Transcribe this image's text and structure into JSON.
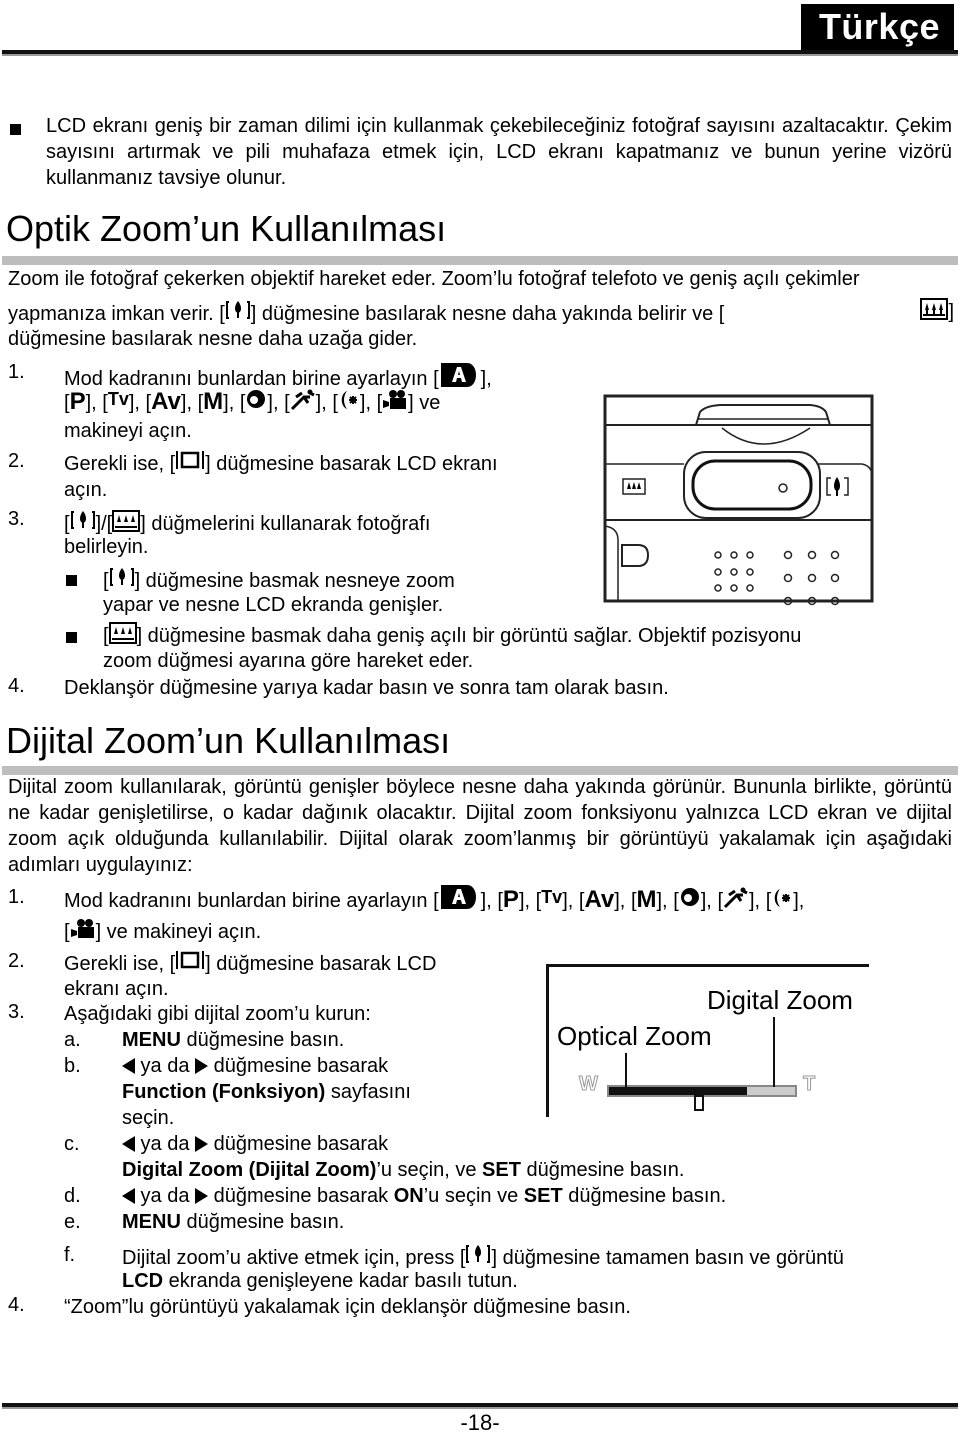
{
  "header": {
    "language_tab": "Türkçe"
  },
  "intro_bullet": "LCD ekranı geniş bir zaman dilimi için kullanmak çekebileceğiniz fotoğraf sayısını azaltacaktır. Çekim sayısını artırmak ve pili muhafaza etmek için, LCD ekranı kapatmanız ve bunun yerine vizörü kullanmanız tavsiye olunur.",
  "optical": {
    "title": "Optik Zoom’un Kullanılması",
    "para_1": "Zoom ile fotoğraf çekerken objektif hareket eder. Zoom’lu fotoğraf telefoto ve geniş açılı çekimler",
    "para_2a": "yapmanıza imkan verir. [",
    "para_2b": "] düğmesine basılarak nesne daha yakında belirir ve [",
    "para_2c": "]",
    "para_3": "düğmesine basılarak nesne daha uzağa gider.",
    "steps": {
      "s1_num": "1.",
      "s1_text": "Mod kadranını bunlardan birine ayarlayın [",
      "s1_end": "],",
      "s1_tail": "ve",
      "s1_line3": "makineyi açın.",
      "s2_num": "2.",
      "s2_a": "Gerekli ise, [",
      "s2_b": "] düğmesine basarak LCD ekranı",
      "s2_line2": "açın.",
      "s3_num": "3.",
      "s3_a": "[",
      "s3_b": "]/[",
      "s3_c": "] düğmelerini kullanarak fotoğrafı",
      "s3_line2": "belirleyin.",
      "sub1_a": "[",
      "sub1_b": "] düğmesine basmak nesneye zoom",
      "sub1_line2": "yapar ve nesne LCD ekranda genişler.",
      "sub2_a": "[",
      "sub2_b": "] düğmesine basmak daha geniş açılı bir görüntü sağlar. Objektif pozisyonu",
      "sub2_line2": "zoom düğmesi ayarına göre hareket eder.",
      "s4_num": "4.",
      "s4_text": "Deklanşör düğmesine yarıya kadar basın ve sonra tam olarak basın."
    }
  },
  "modes": {
    "p": "P",
    "tv": "Tv",
    "av": "Av",
    "m": "M",
    "sep_open": "[",
    "sep_close": "],"
  },
  "digital": {
    "title": "Dijital Zoom’un Kullanılması",
    "para": "Dijital zoom kullanılarak, görüntü genişler böylece nesne daha yakında görünür. Bununla birlikte, görüntü ne kadar genişletilirse, o kadar dağınık olacaktır. Dijital zoom fonksiyonu yalnızca LCD ekran ve dijital zoom açık olduğunda kullanılabilir. Dijital olarak zoom’lanmış bir görüntüyü yakalamak için aşağıdaki adımları uygulayınız:",
    "s1_num": "1.",
    "s1_text": "Mod kadranını bunlardan birine ayarlayın [",
    "s1_line2_a": "[",
    "s1_line2_b": "] ve makineyi açın.",
    "s2_num": "2.",
    "s2_a": "Gerekli ise, [",
    "s2_b": "] düğmesine basarak LCD",
    "s2_line2": "ekranı açın.",
    "s3_num": "3.",
    "s3_text": "Aşağıdaki gibi dijital zoom’u kurun:",
    "a_label": "a.",
    "a_bold": "MENU",
    "a_text": " düğmesine basın.",
    "b_label": "b.",
    "b_mid": " ya da ",
    "b_text": " düğmesine basarak",
    "b_bold": "Function (Fonksiyon)",
    "b_text2": " sayfasını",
    "b_line3": "seçin.",
    "c_label": "c.",
    "c_mid": " ya da ",
    "c_text": " düğmesine basarak",
    "c_bold1": "Digital Zoom (Dijital Zoom)",
    "c_text2": "’u seçin, ve ",
    "c_bold2": "SET",
    "c_text3": " düğmesine basın.",
    "d_label": "d.",
    "d_mid": " ya da ",
    "d_text": " düğmesine basarak ",
    "d_bold1": "ON",
    "d_text2": "’u seçin ve ",
    "d_bold2": "SET",
    "d_text3": " düğmesine basın.",
    "e_label": "e.",
    "e_bold": "MENU",
    "e_text": " düğmesine basın.",
    "f_label": "f.",
    "f_a": "Dijital zoom’u aktive etmek için, press [",
    "f_b": "] düğmesine tamamen basın ve görüntü",
    "f_bold": "LCD",
    "f_text2": " ekranda genişleyene kadar basılı tutun.",
    "s4_num": "4.",
    "s4_text": "“Zoom”lu görüntüyü yakalamak için deklanşör düğmesine basın."
  },
  "zoom_diagram": {
    "digital_label": "Digital Zoom",
    "optical_label": "Optical Zoom",
    "wide_label": "W",
    "tele_label": "T",
    "optical_fraction": 0.74
  },
  "footer": {
    "page_number": "-18-"
  }
}
